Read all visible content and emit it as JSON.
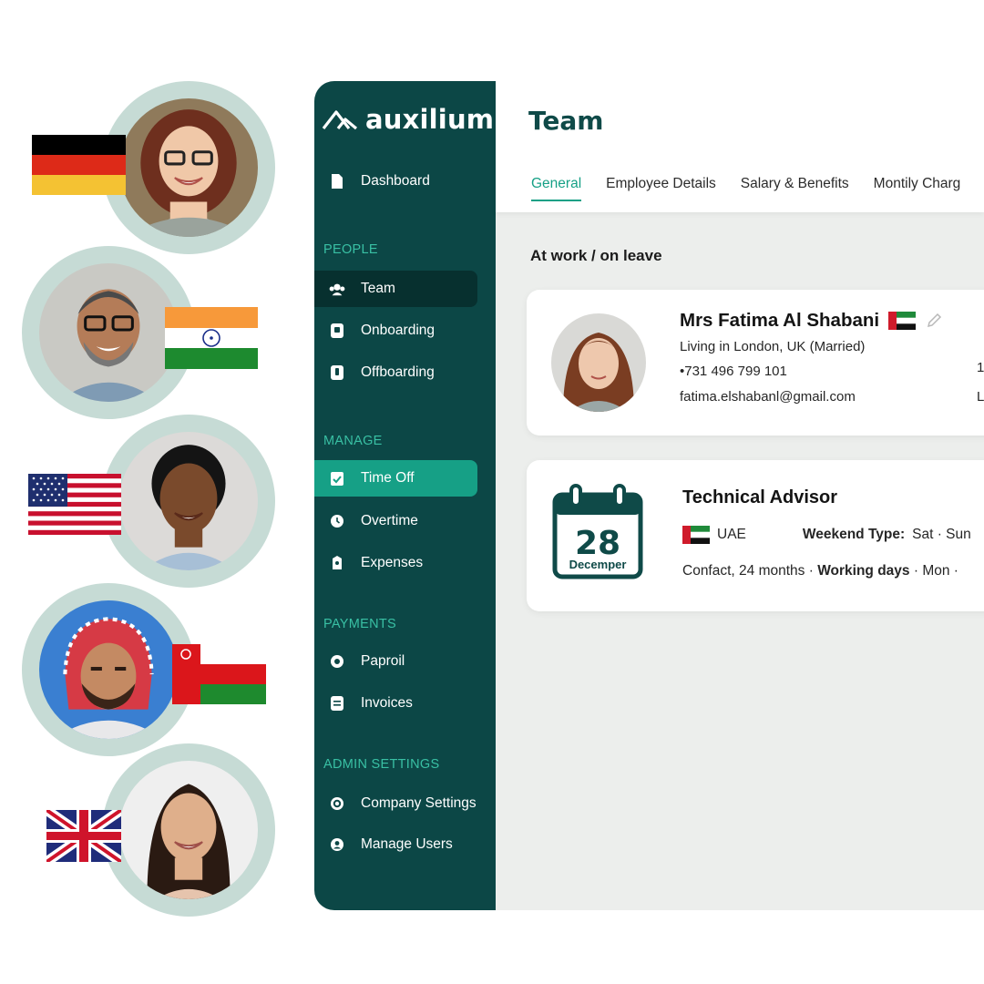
{
  "brand": {
    "name": "auxilium"
  },
  "sidebar": {
    "top_items": [
      {
        "label": "Dashboard",
        "icon": "document-icon"
      }
    ],
    "sections": [
      {
        "title": "PEOPLE",
        "items": [
          {
            "label": "Team",
            "icon": "team-icon",
            "active": true
          },
          {
            "label": "Onboarding",
            "icon": "onboarding-icon"
          },
          {
            "label": "Offboarding",
            "icon": "offboarding-icon"
          }
        ]
      },
      {
        "title": "MANAGE",
        "items": [
          {
            "label": "Time Off",
            "icon": "time-off-icon",
            "highlighted": true
          },
          {
            "label": "Overtime",
            "icon": "overtime-icon"
          },
          {
            "label": "Expenses",
            "icon": "expenses-icon"
          }
        ]
      },
      {
        "title": "PAYMENTS",
        "items": [
          {
            "label": "Paproil",
            "icon": "payroll-icon"
          },
          {
            "label": "Invoices",
            "icon": "invoices-icon"
          }
        ]
      },
      {
        "title": "ADMIN SETTINGS",
        "items": [
          {
            "label": "Company Settings",
            "icon": "company-settings-icon"
          },
          {
            "label": "Manage Users",
            "icon": "manage-users-icon"
          }
        ]
      }
    ]
  },
  "header": {
    "title": "Team",
    "tabs": [
      "General",
      "Employee Details",
      "Salary & Benefits",
      "Montily Charg"
    ],
    "active_tab": "General"
  },
  "section": {
    "heading": "At work / on leave"
  },
  "employee": {
    "name": "Mrs Fatima Al Shabani",
    "location": "Living in London, UK (Married)",
    "phone": "•731 496 799 101",
    "email": "fatima.elshabanl@gmail.com",
    "right_values": [
      "1",
      "L"
    ]
  },
  "role": {
    "title": "Technical Advisor",
    "calendar_day": "28",
    "calendar_month": "Decemper",
    "country": "UAE",
    "weekend_label": "Weekend Type:",
    "weekend_value": "Sat · Sun",
    "contract_text": "Confact, 24 months ·",
    "working_days_label": "Working days",
    "working_days_value": "· Mon ·"
  },
  "colors": {
    "sidebar_bg": "#0c4746",
    "accent_teal": "#16a086",
    "section_label": "#39c0a4",
    "title_color": "#0f4a48",
    "avatar_ring": "#c6dbd5"
  },
  "avatars": [
    {
      "flag": "germany-flag"
    },
    {
      "flag": "india-flag"
    },
    {
      "flag": "usa-flag"
    },
    {
      "flag": "oman-flag"
    },
    {
      "flag": "uk-flag"
    }
  ]
}
